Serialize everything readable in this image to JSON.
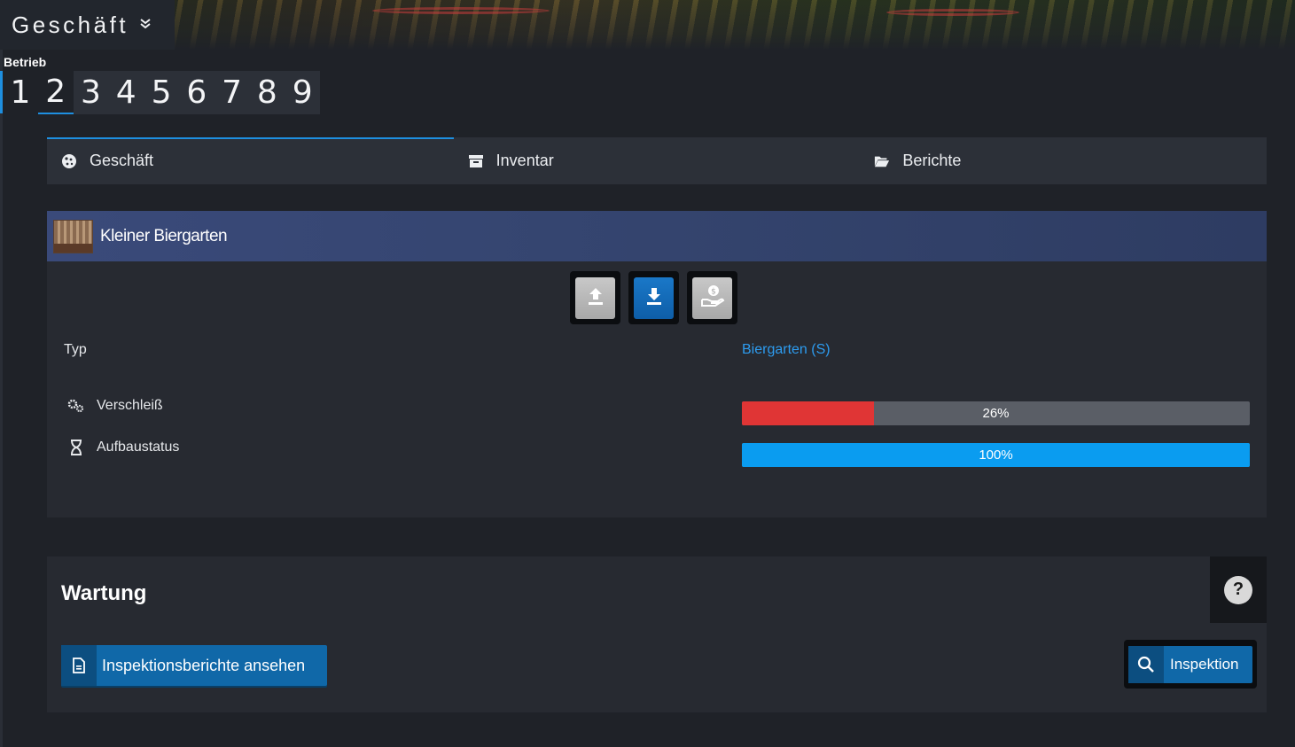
{
  "header": {
    "menu_title": "Geschäft",
    "section_label": "Betrieb",
    "number_tabs": [
      "1",
      "2",
      "3",
      "4",
      "5",
      "6",
      "7",
      "8",
      "9"
    ],
    "active_number": "2"
  },
  "nav": {
    "tabs": [
      {
        "label": "Geschäft",
        "icon": "cookie-icon",
        "active": true
      },
      {
        "label": "Inventar",
        "icon": "archive-box-icon",
        "active": false
      },
      {
        "label": "Berichte",
        "icon": "folder-open-icon",
        "active": false
      }
    ]
  },
  "shop": {
    "name": "Kleiner Biergarten",
    "actions": [
      "upload-icon",
      "download-icon",
      "hand-coin-icon"
    ],
    "type_label": "Typ",
    "type_value": "Biergarten (S)",
    "wear_label": "Verschleiß",
    "wear_percent": 26,
    "wear_text": "26%",
    "build_label": "Aufbaustatus",
    "build_percent": 100,
    "build_text": "100%"
  },
  "maintenance": {
    "title": "Wartung",
    "help_symbol": "?",
    "reports_button": "Inspektionsberichte ansehen",
    "inspect_button": "Inspektion"
  },
  "colors": {
    "accent": "#1e8fe0",
    "wear_bar": "#e03535",
    "build_bar": "#0a9cf0",
    "link": "#2d9cf0"
  }
}
